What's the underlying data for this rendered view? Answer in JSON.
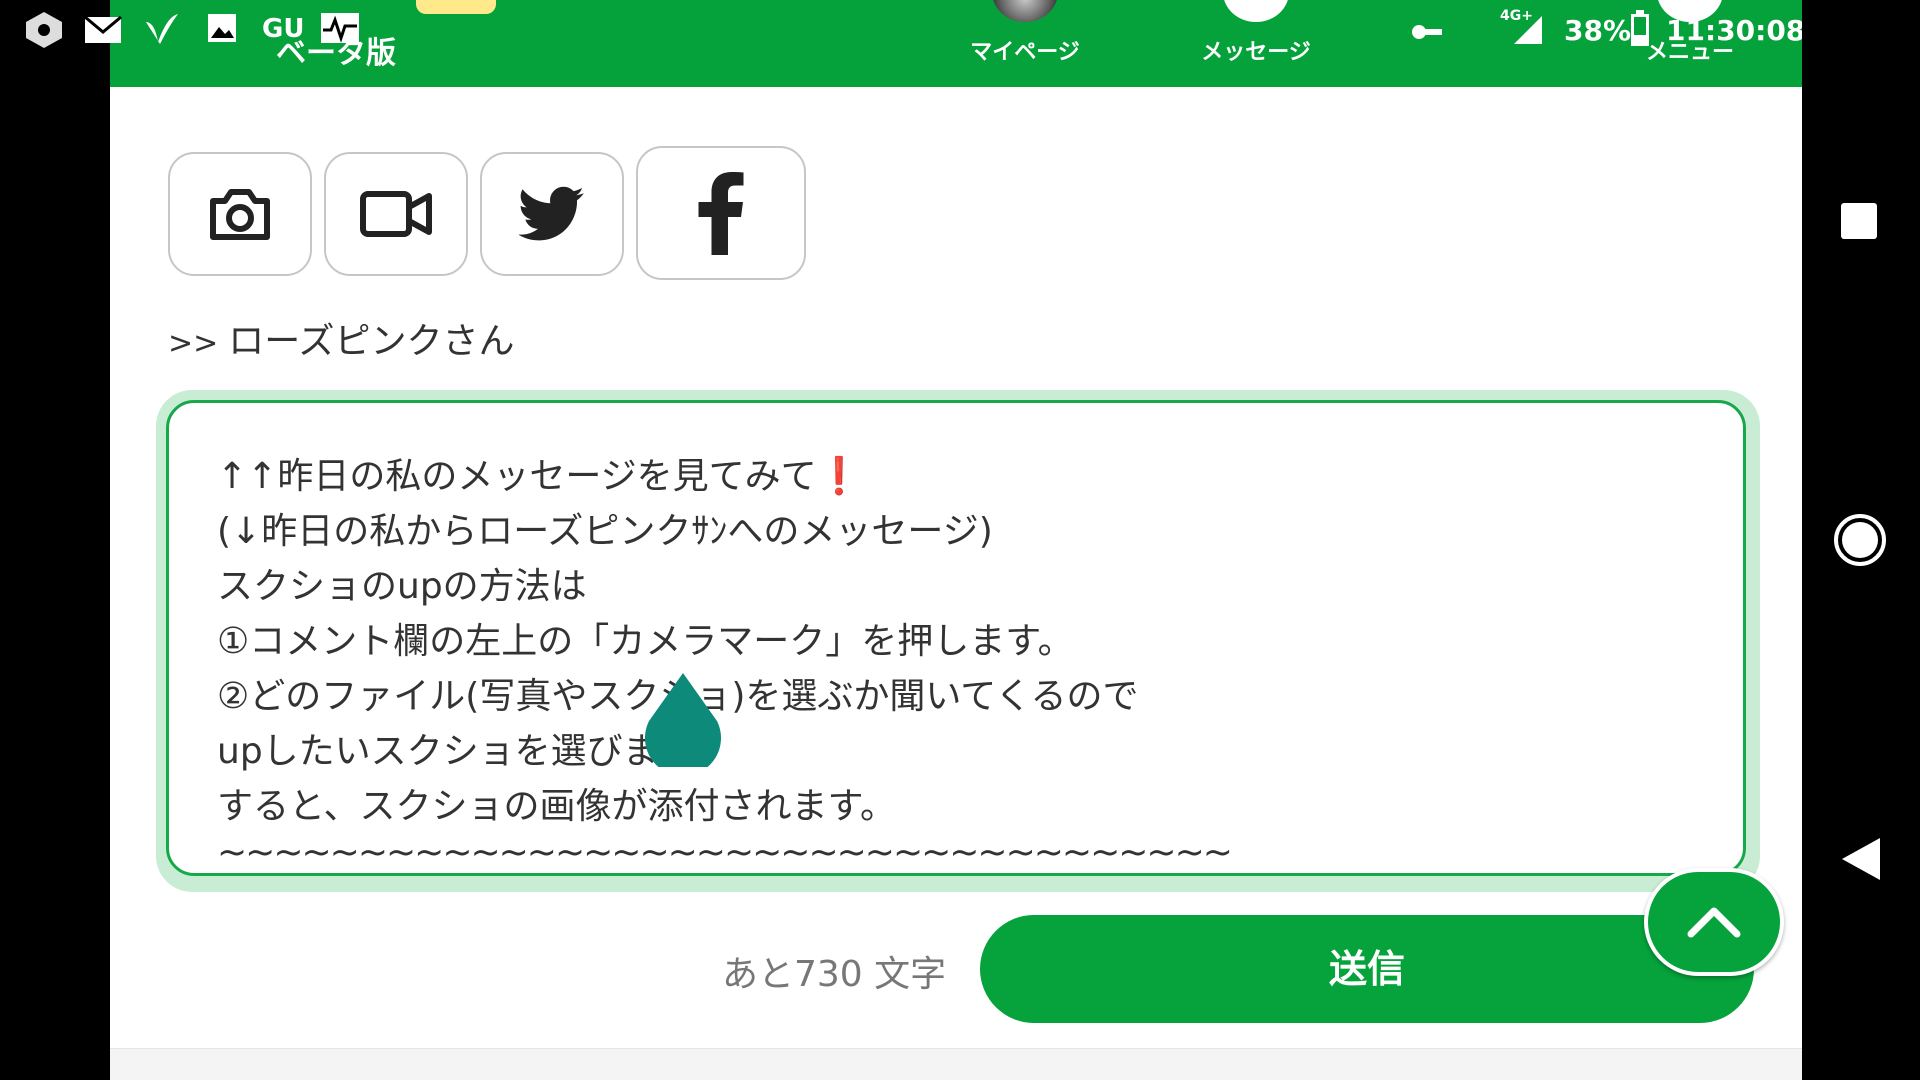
{
  "status_bar": {
    "network": "4G+",
    "battery": "38%",
    "time": "11:30:08",
    "left_icons": [
      "settings-icon",
      "mail-icon",
      "signal-app-icon",
      "gallery-icon",
      "gu-icon",
      "activity-icon"
    ],
    "left_text": "GU"
  },
  "header": {
    "beta_label": "ベータ版",
    "nav": {
      "mypage": "マイページ",
      "messages": "メッセージ",
      "menu": "メニュー"
    },
    "accent_color": "#05a13b"
  },
  "toolbar": {
    "buttons": [
      "camera-icon",
      "video-icon",
      "twitter-icon",
      "facebook-icon"
    ]
  },
  "reply": {
    "prefix": ">>",
    "name": "ローズピンクさん"
  },
  "comment": {
    "lines": [
      "↑↑昨日の私のメッセージを見てみて",
      "(↓昨日の私からローズピンクｻﾝへのメッセージ)",
      "スクショのupの方法は",
      "①コメント欄の左上の「カメラマーク」を押します。",
      "②どのファイル(写真やスクショ)を選ぶか聞いてくるので",
      "upしたいスクショを選びます。",
      "すると、スクショの画像が添付されます。",
      "~~~~~~~~~~~~~~~~~~~~~~~~~~~~~~~~~~~~"
    ],
    "emoji": "❗"
  },
  "footer": {
    "remaining": "あと730 文字",
    "send_label": "送信"
  },
  "colors": {
    "primary": "#06a23b",
    "border": "#17a84a",
    "focus_glow": "#c8ecd4",
    "cursor_drop": "#0e8a7a"
  }
}
